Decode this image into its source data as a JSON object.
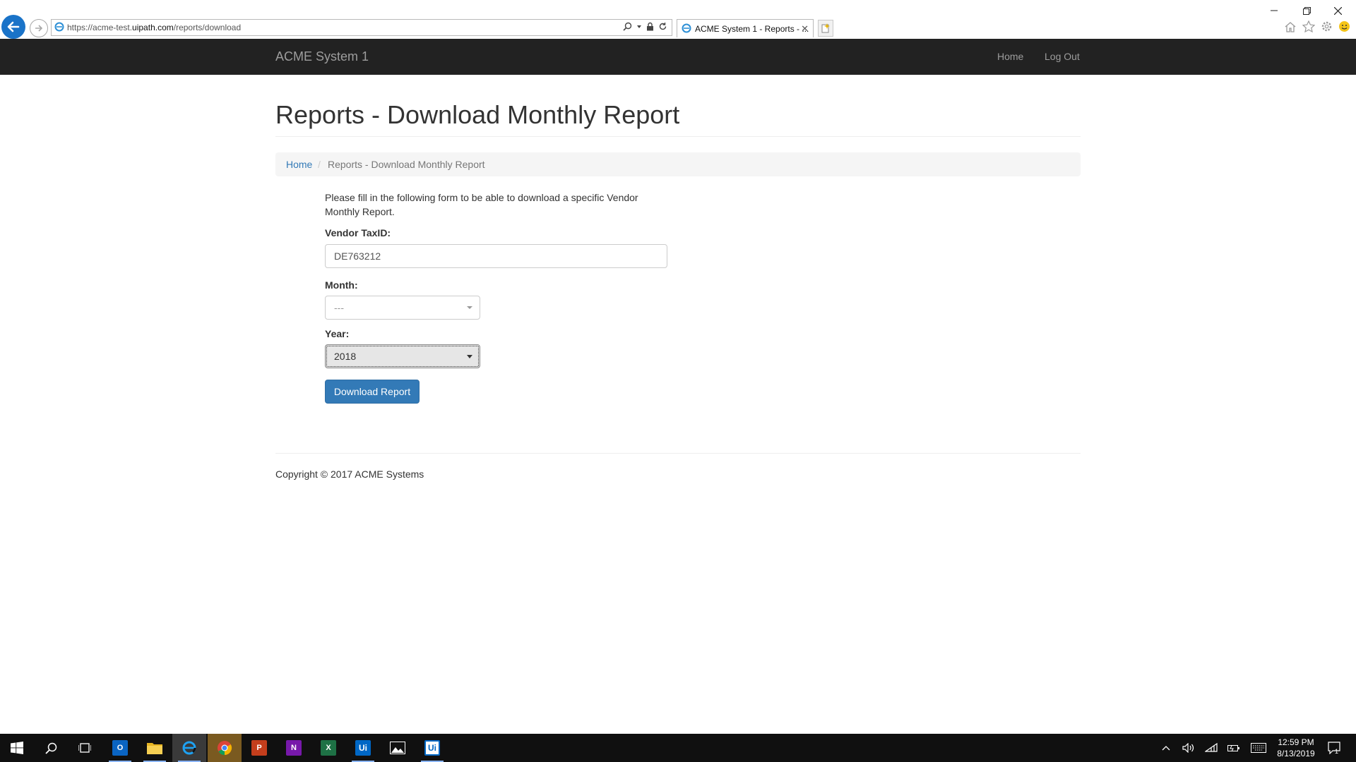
{
  "browser": {
    "url_prefix": "https://acme-test.",
    "url_domain": "uipath.com",
    "url_path": "/reports/download",
    "tab_title": "ACME System 1 - Reports - ...",
    "tab_close": "✕"
  },
  "navbar": {
    "brand": "ACME System 1",
    "links": [
      "Home",
      "Log Out"
    ]
  },
  "page": {
    "title": "Reports - Download Monthly Report",
    "breadcrumb": {
      "home": "Home",
      "separator": "/",
      "current": "Reports - Download Monthly Report"
    },
    "intro": "Please fill in the following form to be able to download a specific Vendor Monthly Report."
  },
  "form": {
    "vendor_label": "Vendor TaxID:",
    "vendor_value": "DE763212",
    "month_label": "Month:",
    "month_value": "---",
    "year_label": "Year:",
    "year_value": "2018",
    "submit_label": "Download Report"
  },
  "footer": {
    "copyright": "Copyright © 2017 ACME Systems"
  },
  "taskbar": {
    "apps": [
      "outlook-icon",
      "file-explorer-icon",
      "internet-explorer-icon",
      "chrome-icon",
      "powerpoint-icon",
      "onenote-icon",
      "excel-icon",
      "uipath-studio-icon",
      "photos-icon",
      "uipath-robot-icon"
    ],
    "time": "12:59 PM",
    "date": "8/13/2019",
    "notification_count": "1"
  },
  "colors": {
    "navbar_bg": "#222222",
    "link": "#337ab7",
    "button_primary": "#337ab7",
    "browser_back": "#1a73c8"
  }
}
